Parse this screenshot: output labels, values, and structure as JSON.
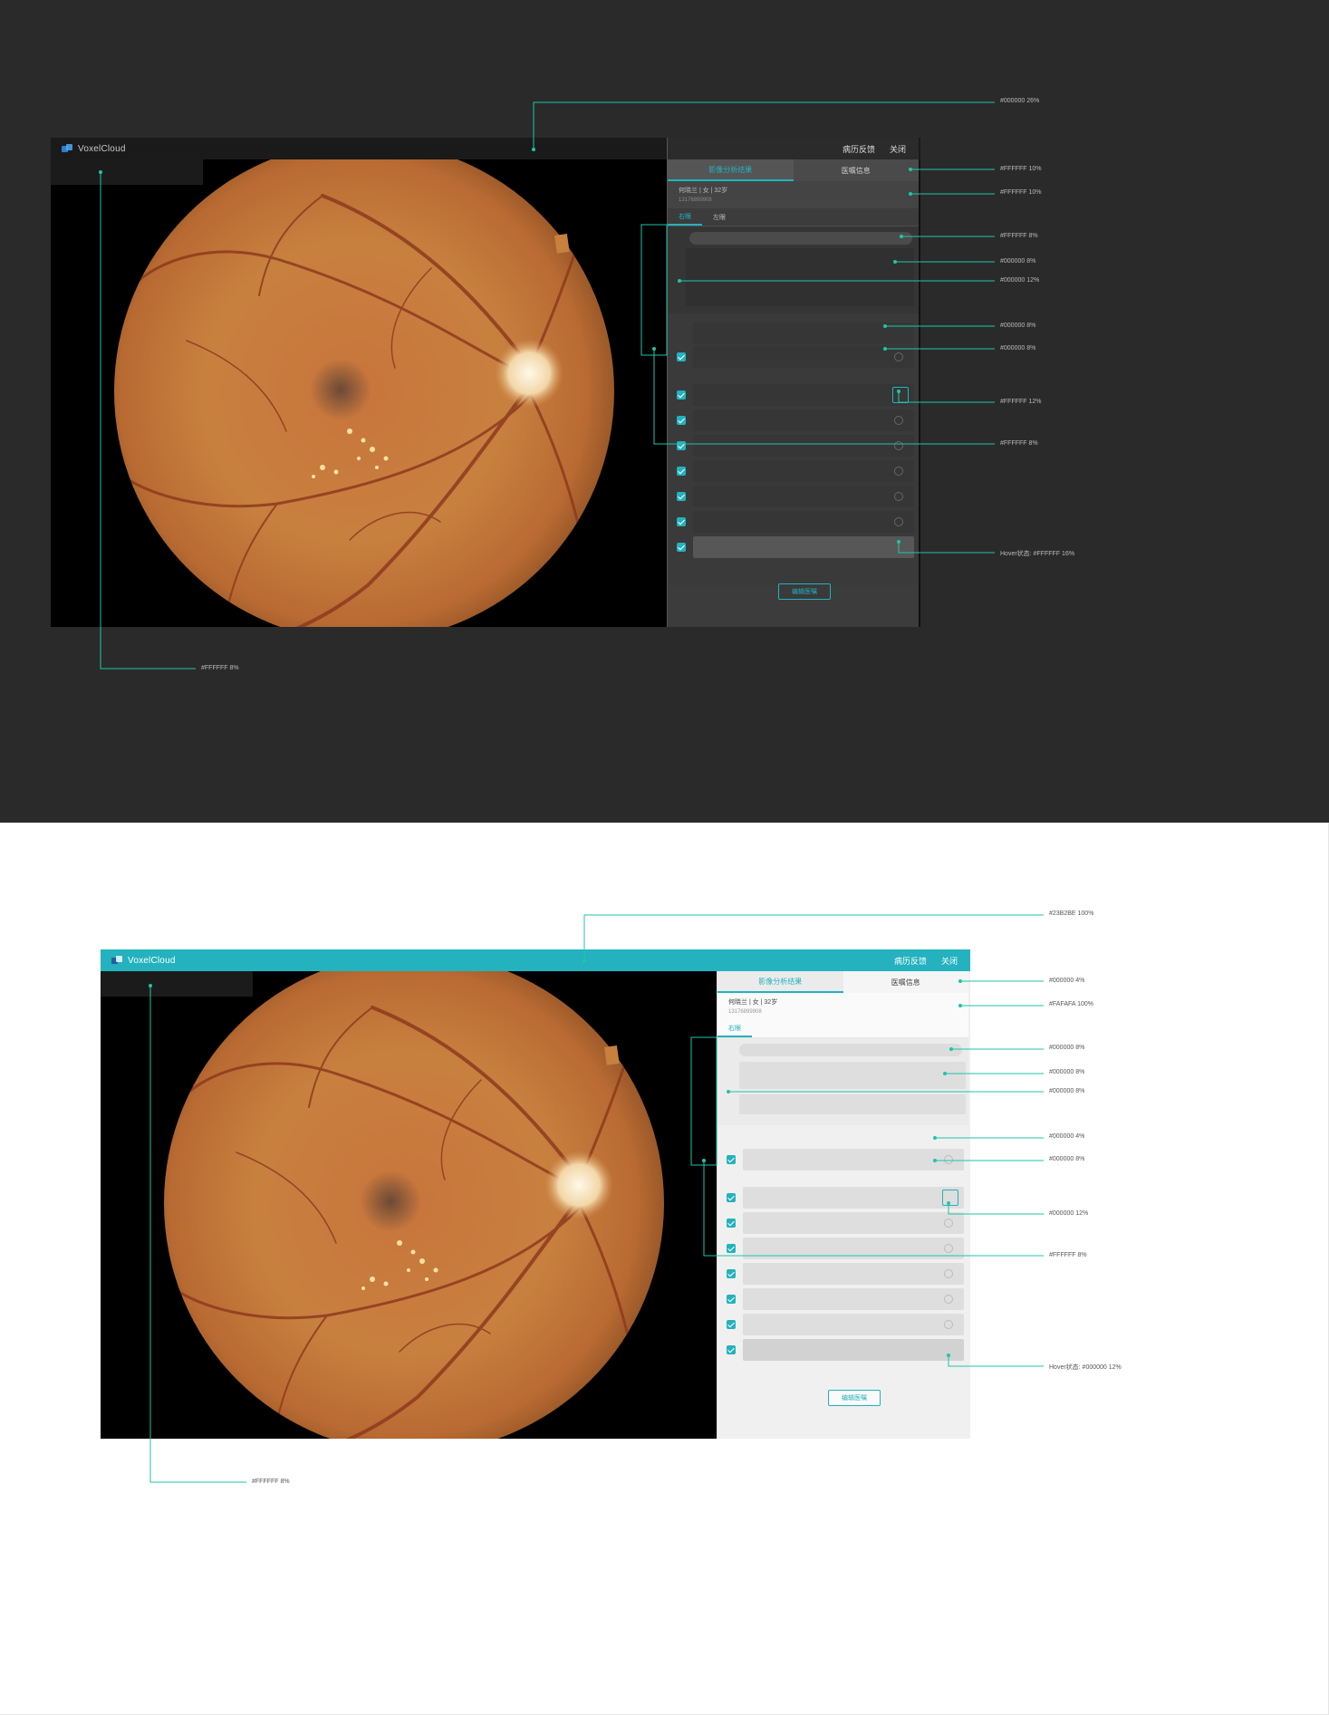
{
  "app": {
    "brand": "VoxelCloud",
    "top_actions": [
      "病历反馈",
      "关闭"
    ]
  },
  "panel": {
    "tabs": [
      "影像分析结果",
      "医嘱信息"
    ],
    "patient": {
      "line": "何晓兰 | 女 | 32岁",
      "phone": "13176899908"
    },
    "eye_tabs_dark": [
      "右眼",
      "左眼"
    ],
    "eye_tabs_light": [
      "右眼"
    ],
    "edit_button": "编辑医嘱"
  },
  "annotations_dark": {
    "topbar": "#000000 26%",
    "tabs": "#FFFFFF 10%",
    "patient": "#FFFFFF 10%",
    "summary_pill": "#FFFFFF 8%",
    "summary_box": "#000000 8%",
    "summary_bg": "#000000 12%",
    "list_bg": "#000000 8%",
    "list_row": "#000000 8%",
    "icon_hover": "#FFFFFF 12%",
    "left_strip": "#FFFFFF 8%",
    "row_hover": "Hover状态:   #FFFFFF 16%",
    "viewer_strip": "#FFFFFF 8%"
  },
  "annotations_light": {
    "topbar": "#23B2BE 100%",
    "tabs": "#000000 4%",
    "patient": "#FAFAFA 100%",
    "summary_pill": "#000000 8%",
    "summary_box": "#000000 8%",
    "summary_bg": "#000000 8%",
    "list_bg": "#000000 4%",
    "list_row": "#000000 8%",
    "icon_hover": "#000000 12%",
    "left_strip": "#FFFFFF 8%",
    "row_hover": "Hover状态: #000000 12%",
    "viewer_strip": "#FFFFFF 8%"
  },
  "colors": {
    "accent": "#23B2BE",
    "dark_bg": "#2a2a2a",
    "annotation_line": "#1fc5a8"
  },
  "icons": [
    "voxelcloud-logo-icon",
    "checkbox-checked-icon",
    "circle-action-icon",
    "cursor-hand-icon"
  ]
}
